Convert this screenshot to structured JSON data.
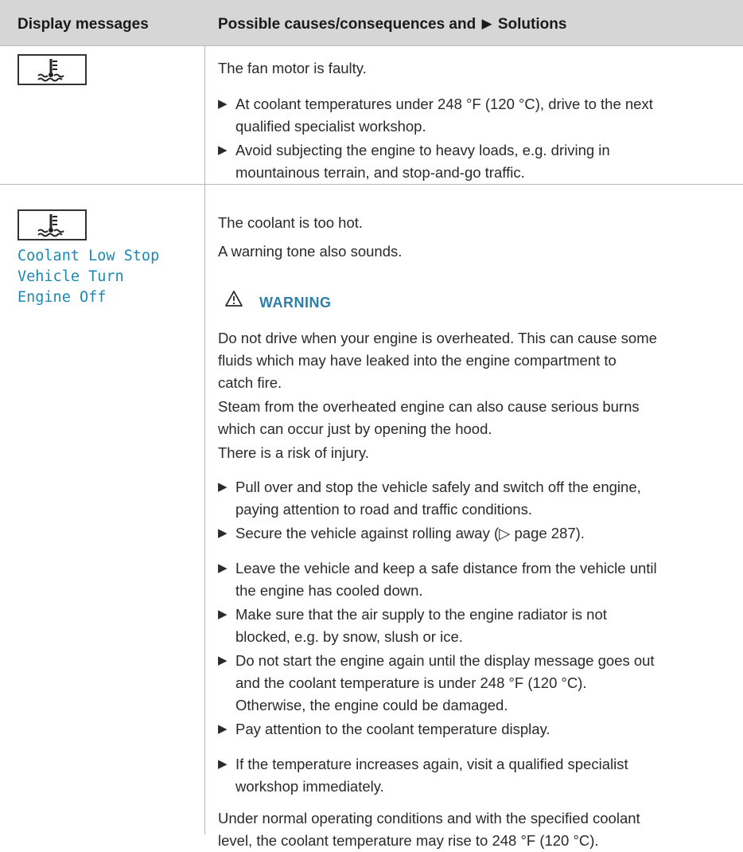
{
  "header": {
    "col1": "Display messages",
    "col2_prefix": "Possible causes/consequences and",
    "col2_marker": "▶",
    "col2_suffix": "Solutions"
  },
  "icons": {
    "row1": "coolant-temperature-icon",
    "row2": "coolant-temperature-icon"
  },
  "row1": {
    "cause": "The fan motor is faulty.",
    "bullets": [
      [
        "At coolant temperatures under 248 °F (120 °C), drive to the next",
        "qualified specialist workshop."
      ],
      [
        "Avoid subjecting the engine to heavy loads, e.g. driving in",
        "mountainous terrain, and stop-and-go traffic."
      ]
    ]
  },
  "row2": {
    "message": [
      "Coolant Low Stop",
      "Vehicle Turn",
      "Engine Off"
    ],
    "cause1": "The coolant is too hot.",
    "cause2": "A warning tone also sounds.",
    "warning_label": "WARNING",
    "warning_text": [
      "Do not drive when your engine is overheated. This can cause some",
      "fluids which may have leaked into the engine compartment to",
      "catch fire.",
      "Steam from the overheated engine can also cause serious burns",
      "which can occur just by opening the hood.",
      "There is a risk of injury."
    ],
    "bullets": [
      [
        "Pull over and stop the vehicle safely and switch off the engine,",
        "paying attention to road and traffic conditions."
      ],
      [
        "Secure the vehicle against rolling away (▷ page 287)."
      ],
      [
        "Leave the vehicle and keep a safe distance from the vehicle until",
        "the engine has cooled down."
      ],
      [
        "Make sure that the air supply to the engine radiator is not",
        "blocked, e.g. by snow, slush or ice."
      ],
      [
        "Do not start the engine again until the display message goes out",
        "and the coolant temperature is under 248 °F (120 °C).",
        "Otherwise, the engine could be damaged."
      ],
      [
        "Pay attention to the coolant temperature display."
      ],
      [
        "If the temperature increases again, visit a qualified specialist",
        "workshop immediately."
      ]
    ],
    "closing": [
      "Under normal operating conditions and with the specified coolant",
      "level, the coolant temperature may rise to 248 °F (120 °C)."
    ]
  }
}
